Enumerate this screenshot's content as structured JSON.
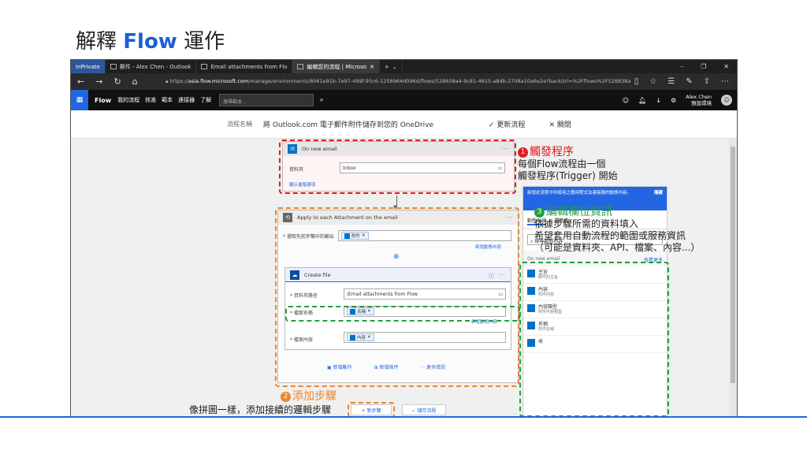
{
  "slide": {
    "title_prefix": "解釋 ",
    "title_brand": "Flow",
    "title_suffix": " 運作"
  },
  "browser": {
    "tabs": [
      {
        "label": "InPrivate"
      },
      {
        "label": "郵件 - Alex Chen - Outlook"
      },
      {
        "label": "Email attachments from Flo"
      },
      {
        "label": "編輯您的流程 | Microso"
      }
    ],
    "new_tab": "+",
    "url_prefix": "https://",
    "url_host": "asia.flow.microsoft.com",
    "url_rest": "/manage/environments/8061e91b-7e97-499f-95c6-1258964d096d/flows/528838a4-9c81-4815-a8db-2708a10a6e2e?backUrl=%2Fflows%2F528838a4-"
  },
  "flow_header": {
    "brand": "Flow",
    "menu": [
      "我的流程",
      "核准",
      "範本",
      "連接器",
      "了解"
    ],
    "search_placeholder": "搜尋範本...",
    "user_name": "Alex Chen",
    "user_env": "預設環境"
  },
  "name_bar": {
    "label": "流程名稱",
    "name": "將 Outlook.com 電子郵件附件儲存到您的 OneDrive",
    "update": "✓ 更新流程",
    "close": "✕ 關閉"
  },
  "trigger_card": {
    "title": "On new email",
    "folder_label": "資料夾",
    "folder_value": "Inbox",
    "advanced": "顯示進階選項"
  },
  "loop_card": {
    "title": "Apply to each Attachment on the email",
    "select_label": "* 選取先前步驟中的輸出",
    "token": "附件",
    "add_dynamic": "新增動態內容"
  },
  "create_file": {
    "title": "Create file",
    "path_label": "* 資料夾路徑",
    "path_value": "/Email attachments from Flow",
    "name_label": "* 檔案名稱",
    "name_token": "名稱",
    "add_dynamic": "新增動態內容",
    "content_label": "* 檔案內容",
    "content_token": "內容"
  },
  "loop_footer": {
    "add_action": "新增動作",
    "add_condition": "新增條件",
    "more": "··· 更多資訊"
  },
  "bottom": {
    "new_step": "+ 新步驟",
    "save": "✓ 儲存流程"
  },
  "dynamic_panel": {
    "header": "新增此流程中所使用之應用程式及連接器的動態內容。",
    "hide": "隱藏",
    "tabs": [
      "動態內容",
      "運算式"
    ],
    "search_placeholder": "搜尋動態內容",
    "section": "On new email",
    "see_more": "查看更多",
    "items": [
      {
        "name": "主旨",
        "desc": "郵件的主旨"
      },
      {
        "name": "內容",
        "desc": "附件內容"
      },
      {
        "name": "內容類型",
        "desc": "附件內容類型"
      },
      {
        "name": "名稱",
        "desc": "附件名稱"
      },
      {
        "name": "收",
        "desc": ""
      }
    ]
  },
  "annotations": {
    "a1_num": "1",
    "a1_title": "觸發程序",
    "a1_line1": "每個Flow流程由一個",
    "a1_line2": "觸發程序(Trigger) 開始",
    "a3_num": "3",
    "a3_title": "編輯欄位資訊",
    "a3_line1": "依據步驟所需的資料填入",
    "a3_line2": "希望套用自動流程的範圍或服務資訊",
    "a3_line3": "（可能是資料夾、API、檔案、內容...）",
    "a2_num": "2",
    "a2_title": "添加步驟",
    "a2_line1": "像拼圖一樣，添加接續的邏輯步驟"
  },
  "colors": {
    "accent": "#2266e3",
    "annotation_red": "#e01b1b",
    "annotation_orange": "#e8862f",
    "annotation_green": "#20a040"
  }
}
